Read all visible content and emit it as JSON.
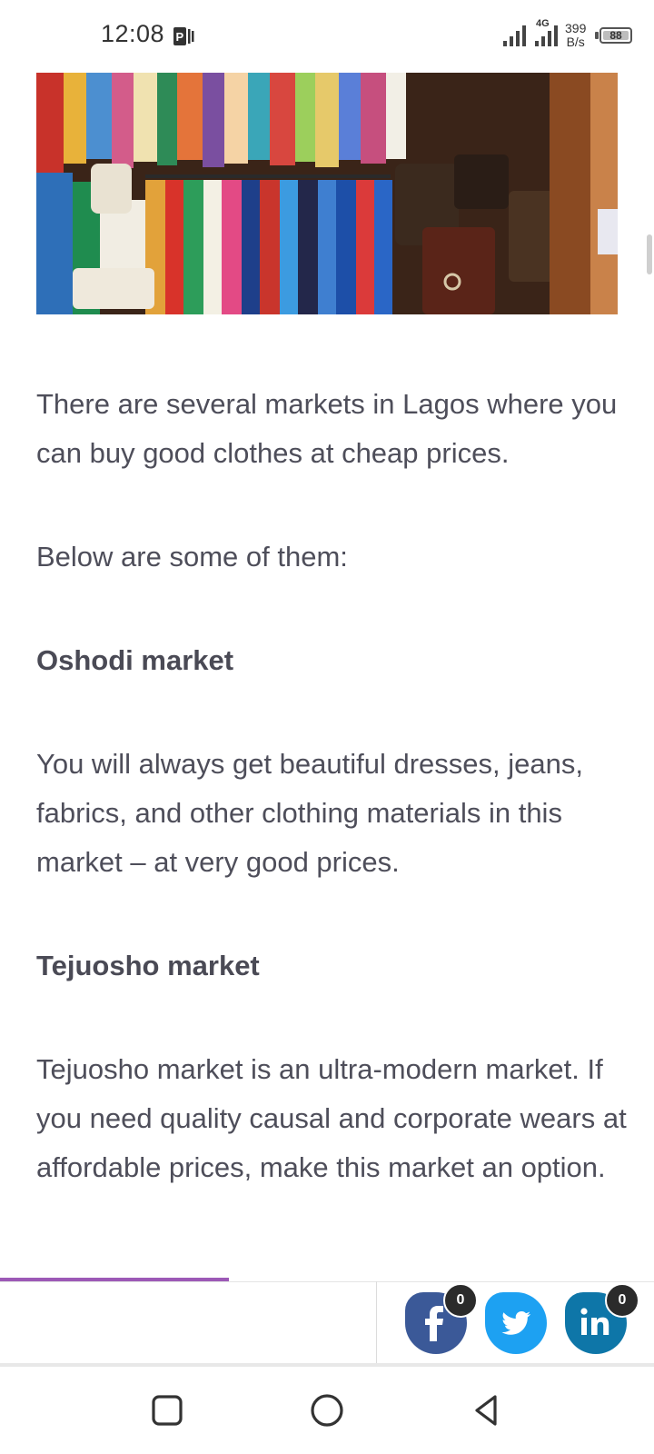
{
  "status_bar": {
    "time": "12:08",
    "network_type": "4G",
    "speed_value": "399",
    "speed_unit": "B/s",
    "battery_level": "88"
  },
  "hero_image": {
    "alt": "Clothes and bags hanging in a market stall"
  },
  "article": {
    "intro": "There are several markets in Lagos where you can buy good clothes at cheap prices.",
    "list_intro": "Below are some of them:",
    "sections": [
      {
        "heading": "Oshodi market",
        "body": "You will always get beautiful dresses, jeans, fabrics, and other clothing materials in this market – at very good prices."
      },
      {
        "heading": "Tejuosho market",
        "body": "Tejuosho market is an ultra-modern market. If you need quality causal and corporate wears at affordable prices, make this market an option."
      }
    ]
  },
  "reading_progress": 0.35,
  "share_bar": {
    "facebook_count": "0",
    "linkedin_count": "0",
    "linkedin_label": "in",
    "facebook_label": "f"
  },
  "colors": {
    "progress": "#9c59b6",
    "facebook": "#3b5998",
    "twitter": "#1da1f2",
    "linkedin": "#0e76a8"
  },
  "icons": [
    "app-notification-icon",
    "signal-icon",
    "battery-icon",
    "facebook-icon",
    "twitter-icon",
    "linkedin-icon",
    "recent-apps-icon",
    "home-icon",
    "back-icon"
  ]
}
